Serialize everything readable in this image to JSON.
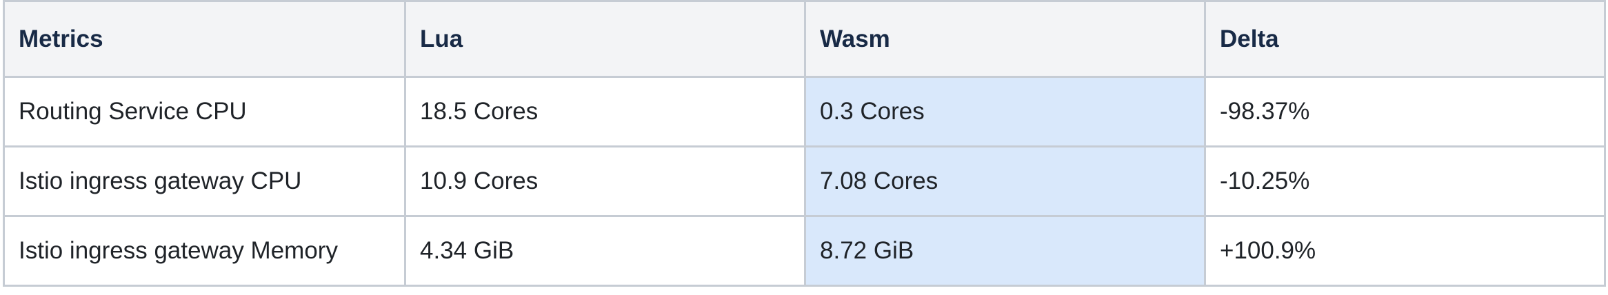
{
  "table": {
    "headers": [
      "Metrics",
      "Lua",
      "Wasm",
      "Delta"
    ],
    "rows": [
      [
        "Routing Service CPU",
        "18.5 Cores",
        "0.3 Cores",
        "-98.37%"
      ],
      [
        "Istio ingress gateway CPU",
        "10.9 Cores",
        "7.08 Cores",
        "-10.25%"
      ],
      [
        "Istio ingress gateway Memory",
        "4.34 GiB",
        "8.72 GiB",
        "+100.9%"
      ]
    ],
    "highlight_column": "Wasm",
    "colors": {
      "header_bg": "#f3f4f6",
      "highlight_bg": "#d9e8fb",
      "border": "#c6ccd4"
    }
  }
}
